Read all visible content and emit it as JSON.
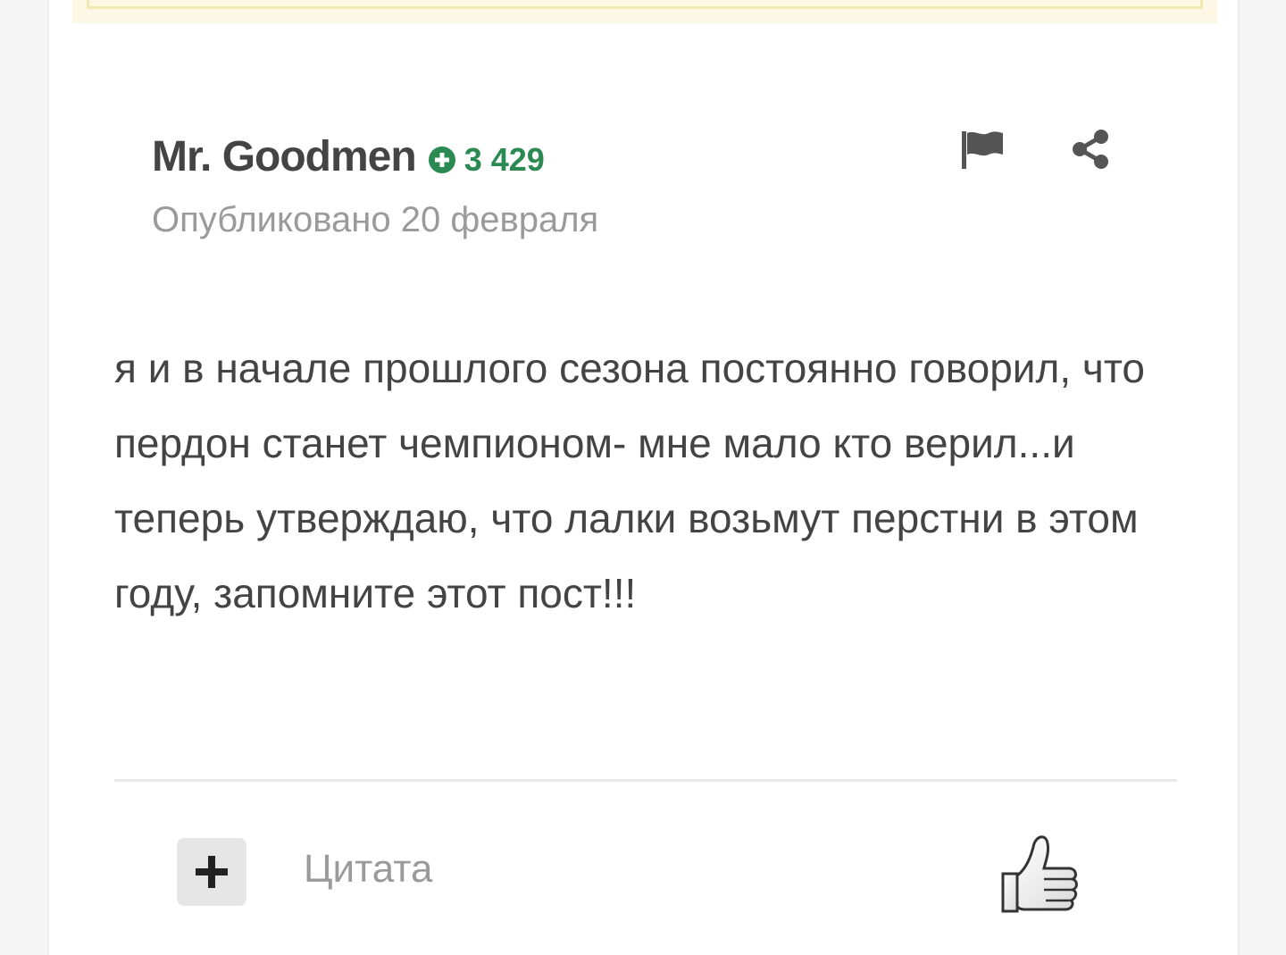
{
  "comment": {
    "author": {
      "name": "Mr. Goodmen",
      "rating": "3 429",
      "rating_color": "#2b8a52"
    },
    "published": "Опубликовано 20 февраля",
    "text": "я и в начале прошлого сезона постоянно говорил, что пердон станет чемпионом- мне мало кто верил...и теперь утверждаю, что лалки возьмут перстни в этом году, запомните этот пост!!!",
    "actions": {
      "report_icon": "flag-icon",
      "share_icon": "share-icon",
      "add_icon": "plus-icon",
      "quote_label": "Цитата",
      "like_icon": "thumbs-up-icon"
    }
  }
}
